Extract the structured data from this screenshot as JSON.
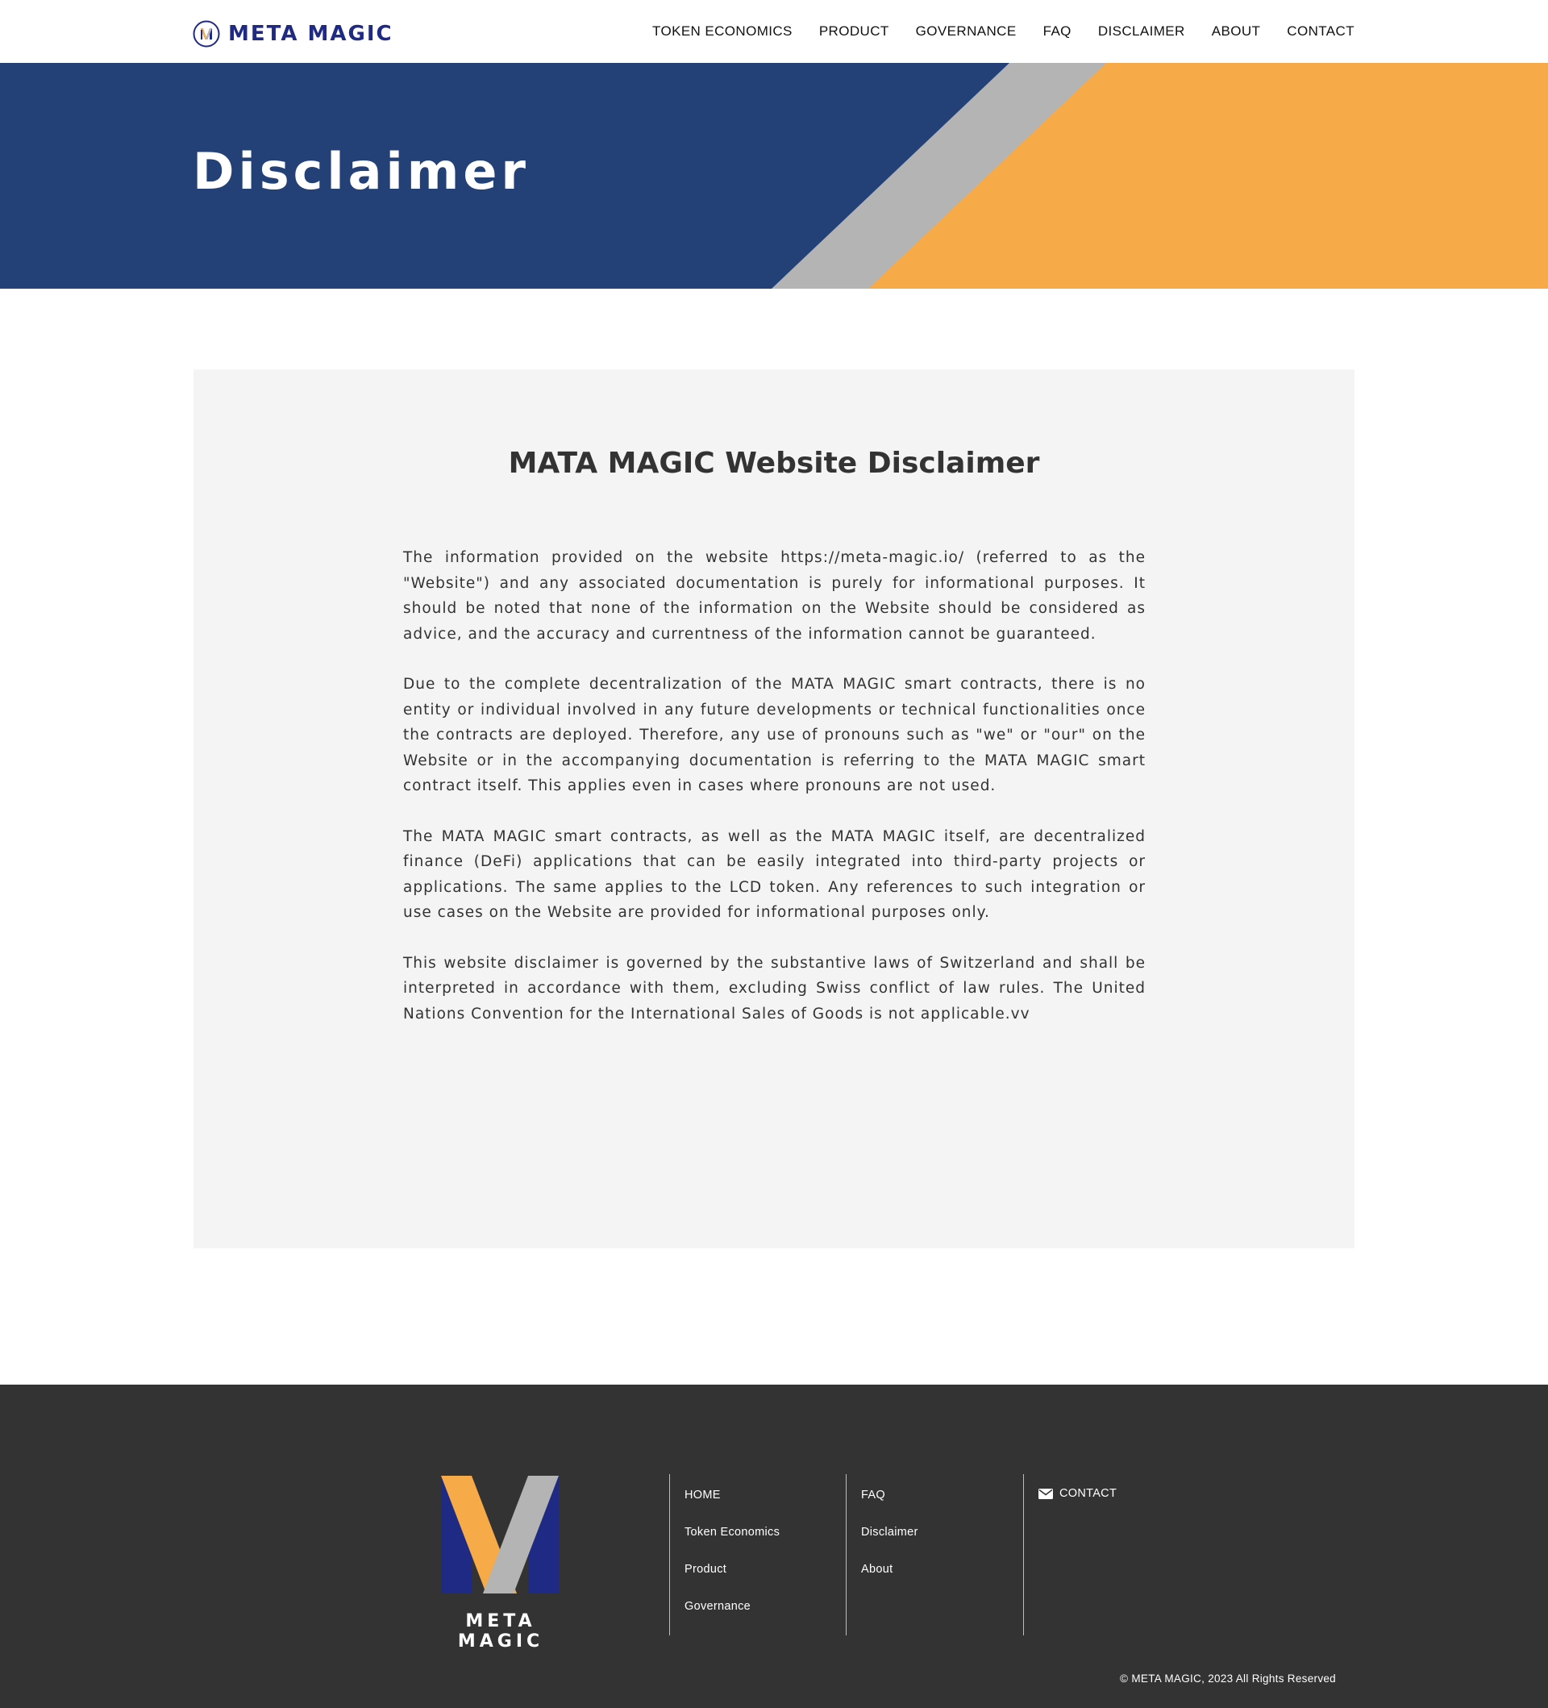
{
  "header": {
    "brand_name": "META MAGIC",
    "nav": [
      {
        "label": "TOKEN ECONOMICS"
      },
      {
        "label": "PRODUCT"
      },
      {
        "label": "GOVERNANCE"
      },
      {
        "label": "FAQ"
      },
      {
        "label": "DISCLAIMER"
      },
      {
        "label": "ABOUT"
      },
      {
        "label": "CONTACT"
      }
    ]
  },
  "hero": {
    "title": "Disclaimer",
    "colors": {
      "blue": "#234177",
      "gray": "#b4b4b4",
      "orange": "#f6aa48"
    }
  },
  "content": {
    "title": "MATA MAGIC Website Disclaimer",
    "paragraphs": [
      "The information provided on the website https://meta-magic.io/ (referred to as the \"Website\") and any associated documentation is purely for informational purposes. It should be noted that none of the information on the Website should be considered as advice, and the accuracy and currentness of the information cannot be guaranteed.",
      "Due to the complete decentralization of the MATA MAGIC smart contracts, there is no entity or individual involved in any future developments or technical functionalities once the contracts are deployed. Therefore, any use of pronouns such as \"we\" or \"our\" on the Website or in the accompanying documentation is referring to the MATA MAGIC smart contract itself. This applies even in cases where pronouns are not used.",
      "The MATA MAGIC smart contracts, as well as the MATA MAGIC itself, are decentralized finance (DeFi) applications that can be easily integrated into third-party projects or applications. The same applies to the LCD token. Any references to such integration or use cases on the Website are provided for informational purposes only.",
      "This website disclaimer is governed by the substantive laws of Switzerland and shall be interpreted in accordance with them, excluding Swiss conflict of law rules. The United Nations Convention for the International Sales of Goods is not applicable.vv"
    ]
  },
  "footer": {
    "brand_name": "META MAGIC",
    "col1": [
      {
        "label": "HOME"
      },
      {
        "label": "Token Economics"
      },
      {
        "label": "Product"
      },
      {
        "label": "Governance"
      }
    ],
    "col2": [
      {
        "label": "FAQ"
      },
      {
        "label": "Disclaimer"
      },
      {
        "label": "About"
      }
    ],
    "contact_label": "CONTACT",
    "copyright": "© META MAGIC, 2023 All Rights Reserved",
    "icons": {
      "contact": "envelope-icon"
    }
  }
}
